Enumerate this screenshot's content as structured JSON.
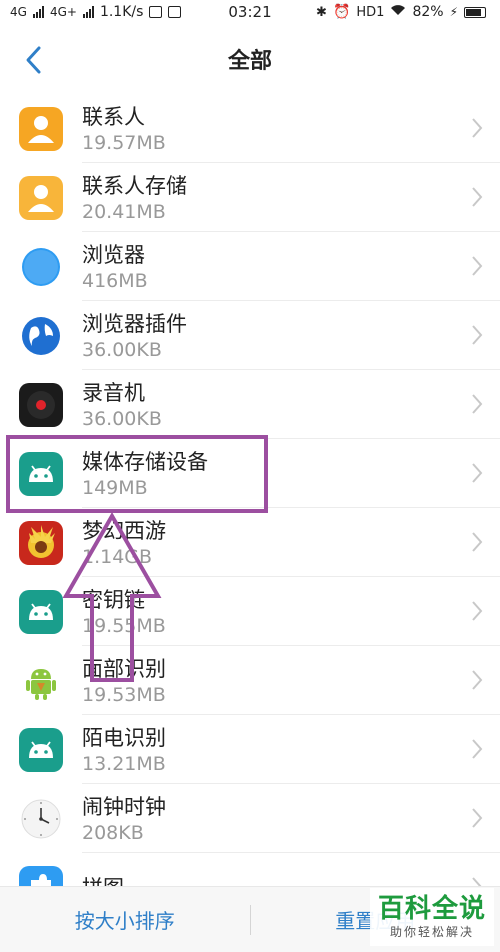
{
  "status_bar": {
    "signal1": "4G",
    "signal2": "4G+",
    "speed": "1.1K/s",
    "time": "03:21",
    "hd": "HD1",
    "battery": "82%"
  },
  "header": {
    "title": "全部"
  },
  "apps": [
    {
      "name": "联系人",
      "size": "19.57MB",
      "icon": "contacts-icon"
    },
    {
      "name": "联系人存储",
      "size": "20.41MB",
      "icon": "contacts-storage-icon"
    },
    {
      "name": "浏览器",
      "size": "416MB",
      "icon": "browser-compass-icon"
    },
    {
      "name": "浏览器插件",
      "size": "36.00KB",
      "icon": "browser-plugin-globe-icon"
    },
    {
      "name": "录音机",
      "size": "36.00KB",
      "icon": "recorder-icon"
    },
    {
      "name": "媒体存储设备",
      "size": "149MB",
      "icon": "android-icon"
    },
    {
      "name": "梦幻西游",
      "size": "1.14GB",
      "icon": "game-icon"
    },
    {
      "name": "密钥链",
      "size": "19.55MB",
      "icon": "android-icon"
    },
    {
      "name": "面部识别",
      "size": "19.53MB",
      "icon": "android-robot-icon"
    },
    {
      "name": "陌电识别",
      "size": "13.21MB",
      "icon": "android-icon"
    },
    {
      "name": "闹钟时钟",
      "size": "208KB",
      "icon": "clock-icon"
    },
    {
      "name": "拼图",
      "size": "",
      "icon": "puzzle-icon"
    }
  ],
  "bottom_bar": {
    "sort_by_size": "按大小排序",
    "reset_app": "重置应用"
  },
  "watermark": {
    "title": "百科全说",
    "subtitle": "助你轻松解决"
  },
  "colors": {
    "accent": "#2f7fc8",
    "annotation": "#9c4fa0",
    "android_green": "#1a9e8c"
  }
}
